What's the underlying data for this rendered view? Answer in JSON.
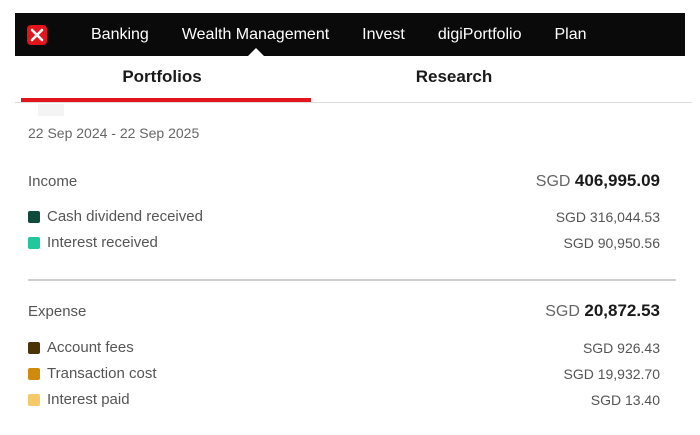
{
  "nav": {
    "items": [
      "Banking",
      "Wealth Management",
      "Invest",
      "digiPortfolio",
      "Plan"
    ],
    "active": "Wealth Management"
  },
  "tabs": [
    "Portfolios",
    "Research"
  ],
  "date_range": "22 Sep 2024 - 22 Sep 2025",
  "income": {
    "label": "Income",
    "currency": "SGD",
    "total": "406,995.09",
    "items": [
      {
        "label": "Cash dividend received",
        "value": "SGD 316,044.53",
        "color": "#0f4b3a"
      },
      {
        "label": "Interest received",
        "value": "SGD 90,950.56",
        "color": "#22c79b"
      }
    ]
  },
  "expense": {
    "label": "Expense",
    "currency": "SGD",
    "total": "20,872.53",
    "items": [
      {
        "label": "Account fees",
        "value": "SGD 926.43",
        "color": "#4a3306"
      },
      {
        "label": "Transaction cost",
        "value": "SGD 19,932.70",
        "color": "#d08a0d"
      },
      {
        "label": "Interest paid",
        "value": "SGD 13.40",
        "color": "#f6c96a"
      }
    ]
  },
  "colors": {
    "brand": "#e2151c",
    "nav_bg": "#0a0a0a"
  },
  "icons": {
    "logo": "dbs-x-logo-icon"
  }
}
